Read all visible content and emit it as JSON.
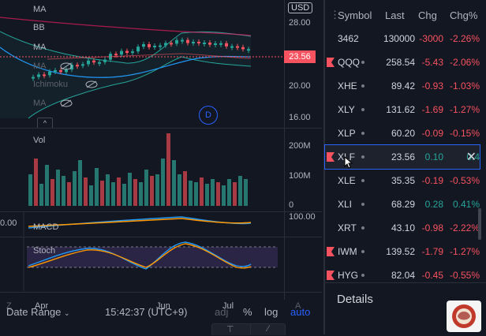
{
  "chart": {
    "currency": "USD",
    "current_price": "23.56",
    "indicators": {
      "ma1": "MA",
      "bb": "BB",
      "ma2": "MA",
      "ma3": "MA",
      "ichimoku": "Ichimoku",
      "ma4": "MA"
    },
    "price_axis": [
      "28.00",
      "24.00",
      "20.00",
      "16.00"
    ],
    "volume_label": "Vol",
    "volume_axis": [
      "200M",
      "100M",
      "0"
    ],
    "macd_label": "MACD",
    "macd_axis_left": "0.00",
    "stoch_label": "Stoch",
    "stoch_axis": "100.00",
    "months": [
      "Apr",
      "Jun",
      "Jul"
    ],
    "event_marker": "D",
    "zoom_left": "Z",
    "zoom_right": "A"
  },
  "bottom_bar": {
    "date_range": "Date Range",
    "time": "15:42:37 (UTC+9)",
    "adj": "adj",
    "percent": "%",
    "log": "log",
    "auto": "auto"
  },
  "watchlist": {
    "headers": {
      "symbol": "Symbol",
      "last": "Last",
      "chg": "Chg",
      "chgp": "Chg%"
    },
    "rows": [
      {
        "symbol": "3462",
        "last": "130000",
        "chg": "-3000",
        "chgp": "-2.26%",
        "dir": "neg",
        "flag": false,
        "dot": false
      },
      {
        "symbol": "QQQ",
        "last": "258.54",
        "chg": "-5.43",
        "chgp": "-2.06%",
        "dir": "neg",
        "flag": true,
        "dot": true
      },
      {
        "symbol": "XHE",
        "last": "89.42",
        "chg": "-0.93",
        "chgp": "-1.03%",
        "dir": "neg",
        "flag": false,
        "dot": true
      },
      {
        "symbol": "XLY",
        "last": "131.62",
        "chg": "-1.69",
        "chgp": "-1.27%",
        "dir": "neg",
        "flag": false,
        "dot": true
      },
      {
        "symbol": "XLP",
        "last": "60.20",
        "chg": "-0.09",
        "chgp": "-0.15%",
        "dir": "neg",
        "flag": false,
        "dot": true
      },
      {
        "symbol": "XLF",
        "last": "23.56",
        "chg": "0.10",
        "chgp": "0.4",
        "dir": "pos",
        "flag": true,
        "dot": true,
        "selected": true
      },
      {
        "symbol": "XLE",
        "last": "35.35",
        "chg": "-0.19",
        "chgp": "-0.53%",
        "dir": "neg",
        "flag": false,
        "dot": true
      },
      {
        "symbol": "XLI",
        "last": "68.29",
        "chg": "0.28",
        "chgp": "0.41%",
        "dir": "pos",
        "flag": false,
        "dot": true
      },
      {
        "symbol": "XRT",
        "last": "43.10",
        "chg": "-0.98",
        "chgp": "-2.22%",
        "dir": "neg",
        "flag": false,
        "dot": true
      },
      {
        "symbol": "IWM",
        "last": "139.52",
        "chg": "-1.79",
        "chgp": "-1.27%",
        "dir": "neg",
        "flag": true,
        "dot": true
      },
      {
        "symbol": "HYG",
        "last": "82.04",
        "chg": "-0.45",
        "chgp": "-0.55%",
        "dir": "neg",
        "flag": true,
        "dot": true
      }
    ],
    "details_label": "Details"
  },
  "colors": {
    "up": "#26a69a",
    "down": "#f7525f",
    "accent": "#2962ff"
  }
}
